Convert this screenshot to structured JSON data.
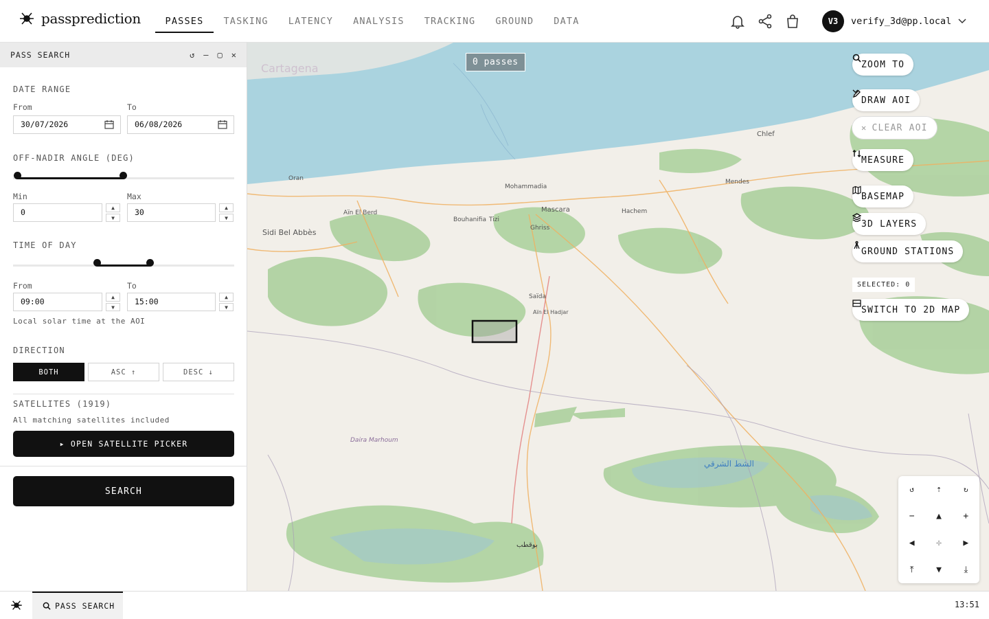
{
  "app": {
    "name": "passprediction"
  },
  "nav": {
    "items": [
      "PASSES",
      "TASKING",
      "LATENCY",
      "ANALYSIS",
      "TRACKING",
      "GROUND",
      "DATA"
    ],
    "active": "PASSES"
  },
  "user": {
    "initials": "V3",
    "email": "verify_3d@pp.local"
  },
  "panel": {
    "title": "PASS SEARCH",
    "date_range": {
      "heading": "DATE RANGE",
      "from_label": "From",
      "to_label": "To",
      "from_value": "30/07/2026",
      "to_value": "06/08/2026"
    },
    "off_nadir": {
      "heading": "OFF-NADIR ANGLE (DEG)",
      "min_label": "Min",
      "max_label": "Max",
      "min_value": "0",
      "max_value": "30"
    },
    "time_of_day": {
      "heading": "TIME OF DAY",
      "from_label": "From",
      "to_label": "To",
      "from_value": "09:00",
      "to_value": "15:00",
      "hint": "Local solar time at the AOI"
    },
    "direction": {
      "heading": "DIRECTION",
      "options": [
        "BOTH",
        "ASC ↑",
        "DESC ↓"
      ],
      "selected": "BOTH"
    },
    "satellites": {
      "heading": "SATELLITES (1919)",
      "hint": "All matching satellites included",
      "picker_label": "▸ OPEN SATELLITE PICKER"
    },
    "search_label": "SEARCH"
  },
  "map": {
    "pass_count": "0 passes",
    "buttons": {
      "zoom_to": "ZOOM TO",
      "draw_aoi": "DRAW AOI",
      "clear_aoi": "CLEAR AOI",
      "measure": "MEASURE",
      "basemap": "BASEMAP",
      "layers_3d": "3D LAYERS",
      "ground_stations": "GROUND STATIONS",
      "switch_2d": "SWITCH TO 2D MAP"
    },
    "selected": "SELECTED: 0",
    "labels": {
      "cartagena": "Cartagena",
      "sidi": "Sidi Bel Abbès",
      "mascara": "Mascara",
      "chlef": "Chlef",
      "daira": "Daira Marhoum",
      "chott": "الشط الشرقي",
      "bougtob": "بوقطب",
      "tizi": "Tizi",
      "bouhanifia": "Bouhanifia",
      "hachem": "Hachem",
      "mendes": "Mendes",
      "saida": "Saïda",
      "ain_hadjar": "Aïn El Hadjar",
      "ain_berd": "Aïn El Berd",
      "ghriss": "Ghriss",
      "oran": "Oran",
      "mohammadia": "Mohammadia"
    }
  },
  "footer": {
    "tab_label": "PASS SEARCH",
    "time": "13:51"
  },
  "colors": {
    "accent": "#111111",
    "water": "#aad3df",
    "forest": "#add19e",
    "land": "#f2efe9"
  }
}
